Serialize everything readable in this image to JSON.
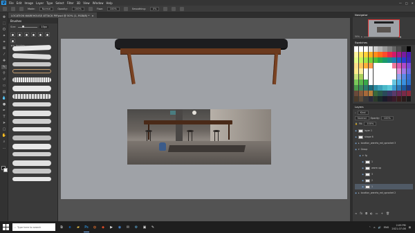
{
  "app": {
    "logo": "Ps",
    "menu": [
      "File",
      "Edit",
      "Image",
      "Layer",
      "Type",
      "Select",
      "Filter",
      "3D",
      "View",
      "Window",
      "Help"
    ],
    "window_controls": [
      "—",
      "□",
      "✕"
    ]
  },
  "options": {
    "mode_label": "Mode:",
    "mode_value": "Normal",
    "opacity_label": "Opacity:",
    "opacity_value": "100%",
    "flow_label": "Flow:",
    "flow_value": "100%",
    "smoothing_label": "Smoothing:",
    "smoothing_value": "0%"
  },
  "document": {
    "tab_title": "LOCATION WAREHOUSE ATTACK PIP.psd @ 50% (1, RGB/8) *",
    "close": "×"
  },
  "brush_panel": {
    "title": "Brushes",
    "size_label": "Size:",
    "size_value": "10px",
    "folder_label": "brushes"
  },
  "navigator": {
    "title": "Navigator",
    "zoom": "50%"
  },
  "swatches": {
    "title": "Swatches",
    "colors": [
      "#ffffff",
      "#ffffff",
      "#ffffff",
      "#e6e6e6",
      "#cccccc",
      "#b3b3b3",
      "#999999",
      "#808080",
      "#666666",
      "#4d4d4d",
      "#333333",
      "#000000",
      "#fff5a0",
      "#ffe65a",
      "#ffd23a",
      "#ffb11e",
      "#ff8c1a",
      "#ff6a1a",
      "#ff4a2a",
      "#e8284a",
      "#d01a6a",
      "#a81a8a",
      "#7a1aa0",
      "#4a1ab0",
      "#e6ff8a",
      "#c8f55a",
      "#a5e64a",
      "#7ad23a",
      "#4dbe3a",
      "#2aa84a",
      "#1a9a6a",
      "#1a8c8c",
      "#1a7ab0",
      "#1a5ac8",
      "#2a3ad2",
      "#3a2ab8",
      "#ffe08a",
      "#ffc85a",
      "#ffb03a",
      "#ff9a4a",
      "#ffffff",
      "#ffffff",
      "#ffffff",
      "#ffffff",
      "#f07a9a",
      "#d85ab0",
      "#b04ac8",
      "#7a4ad8",
      "#ffea8a",
      "#fff0a0",
      "#ffffff",
      "#ffffff",
      "#ffffff",
      "#ffffff",
      "#ffffff",
      "#ffffff",
      "#ffffff",
      "#e090d8",
      "#a07ae8",
      "#6a6ae0",
      "#c8e07a",
      "#a8d05a",
      "#ffffff",
      "#ffffff",
      "#ffffff",
      "#ffffff",
      "#ffffff",
      "#ffffff",
      "#ffffff",
      "#90a8f0",
      "#5a8ae8",
      "#3a6ad2",
      "#7ac85a",
      "#5ab84a",
      "#3aa84a",
      "#ffffff",
      "#ffffff",
      "#ffffff",
      "#ffffff",
      "#ffffff",
      "#6ac8e0",
      "#4ab0e8",
      "#3a90e0",
      "#2a70c8",
      "#4a9a4a",
      "#3a8a5a",
      "#2a7a6a",
      "#1a6a7a",
      "#2a8aa0",
      "#3aa0b8",
      "#4ab8c8",
      "#5ac8d8",
      "#3a9ad0",
      "#2a7ab8",
      "#1a5aa0",
      "#1a3a80",
      "#6a4a3a",
      "#8a5a3a",
      "#a86a3a",
      "#b8803a",
      "#3a6a3a",
      "#2a5a4a",
      "#2a4a5a",
      "#3a3a6a",
      "#5a3a6a",
      "#6a2a5a",
      "#7a2a4a",
      "#8a2a3a",
      "#4a3a2a",
      "#5a4a3a",
      "#3a3a3a",
      "#2a2a3a",
      "#2a3a2a",
      "#1a2a2a",
      "#1a1a2a",
      "#2a1a2a",
      "#3a1a2a",
      "#3a1a1a",
      "#2a1a1a",
      "#1a1a1a"
    ]
  },
  "layers": {
    "title": "Layers",
    "kind_label": "Kind",
    "mode_value": "Normal",
    "opacity_label": "Opacity:",
    "opacity_value": "100%",
    "fill_label": "Fill:",
    "fill_value": "100%",
    "rows": [
      {
        "name": "layer 1"
      },
      {
        "name": "shape 6"
      },
      {
        "name": "location_warehs_ext_sprocket 3"
      },
      {
        "name": "Group"
      },
      {
        "name": "fg"
      },
      {
        "name": "1"
      },
      {
        "name": "warm up"
      },
      {
        "name": "3"
      },
      {
        "name": "2"
      },
      {
        "name": "1"
      },
      {
        "name": "location_warehs_ext_sprocket 2"
      }
    ],
    "footer_icons": [
      "link-icon",
      "fx-icon",
      "mask-icon",
      "adjust-icon",
      "folder-icon",
      "new-icon",
      "trash-icon"
    ]
  },
  "taskbar": {
    "search_placeholder": "Type here to search",
    "time": "2:09 PM",
    "date": "2021-07-08",
    "lang": "ENG"
  }
}
